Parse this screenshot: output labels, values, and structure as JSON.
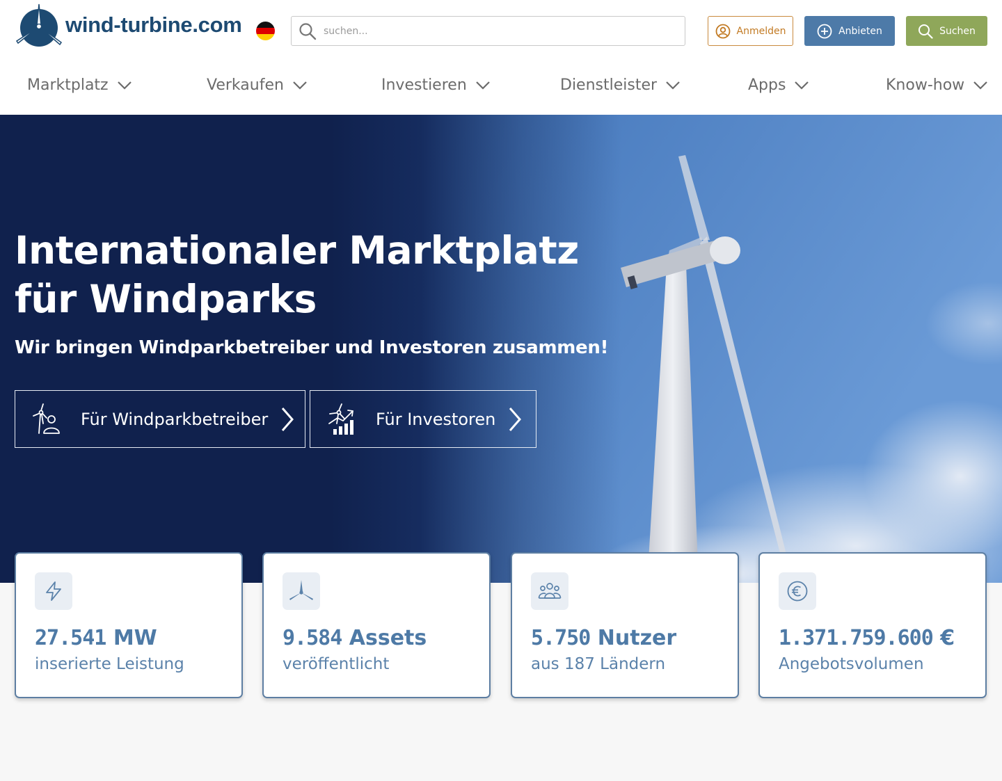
{
  "header": {
    "logo_text": "wind-turbine.com",
    "language": "de",
    "search_placeholder": "suchen...",
    "buttons": {
      "login": "Anmelden",
      "offer": "Anbieten",
      "find": "Suchen"
    }
  },
  "nav": {
    "items": [
      {
        "label": "Marktplatz"
      },
      {
        "label": "Verkaufen"
      },
      {
        "label": "Investieren"
      },
      {
        "label": "Dienstleister"
      },
      {
        "label": "Apps"
      },
      {
        "label": "Know-how"
      }
    ]
  },
  "hero": {
    "title": "Internationaler Marktplatz für Windparks",
    "subtitle": "Wir bringen Windparkbetreiber und Investoren zusammen!",
    "cta_operator": "Für Windparkbetreiber",
    "cta_investor": "Für Investoren"
  },
  "stats": [
    {
      "icon": "lightning-icon",
      "number": "27.541",
      "unit": "MW",
      "label": "inserierte Leistung"
    },
    {
      "icon": "turbine-rotor-icon",
      "number": "9.584",
      "unit": "Assets",
      "label": "veröffentlicht"
    },
    {
      "icon": "users-group-icon",
      "number": "5.750",
      "unit": "Nutzer",
      "label": "aus 187 Ländern"
    },
    {
      "icon": "euro-icon",
      "number": "1.371.759.600",
      "unit": "€",
      "label": "Angebotsvolumen"
    }
  ],
  "colors": {
    "brand_dark": "#1d4a72",
    "login_accent": "#c27a23",
    "offer_blue": "#4d7aa8",
    "find_green": "#8fa75a",
    "hero_navy": "#142652",
    "stat_blue": "#4e7aa6"
  }
}
